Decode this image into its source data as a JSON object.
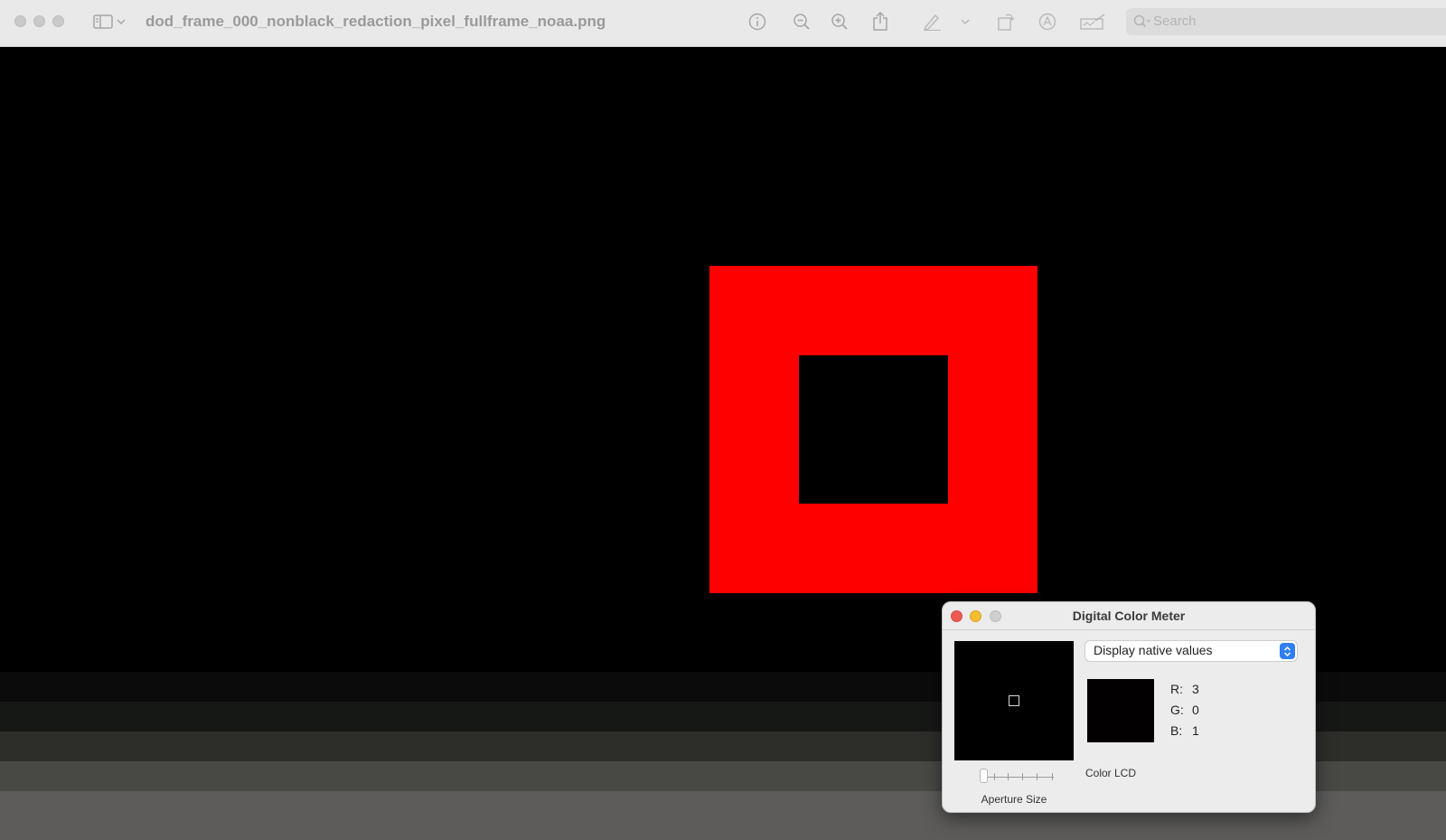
{
  "window": {
    "title": "dod_frame_000_nonblack_redaction_pixel_fullframe_noaa.png"
  },
  "toolbar": {
    "icons": [
      "sidebar-icon",
      "chevron-down-icon",
      "info-icon",
      "zoom-out-icon",
      "zoom-in-icon",
      "share-icon",
      "markup-pen-icon",
      "chevron-down-icon",
      "rotate-icon",
      "annotate-icon",
      "signature-icon"
    ],
    "search_placeholder": "Search"
  },
  "image": {
    "background_color": "#000000",
    "redaction_color": "#ff0000",
    "inner_color": "#000000"
  },
  "color_meter": {
    "title": "Digital Color Meter",
    "mode": "Display native values",
    "aperture_label": "Aperture Size",
    "display_name": "Color LCD",
    "swatch_color": "#030001",
    "r_label": "R:",
    "r_value": "3",
    "g_label": "G:",
    "g_value": "0",
    "b_label": "B:",
    "b_value": "1"
  }
}
